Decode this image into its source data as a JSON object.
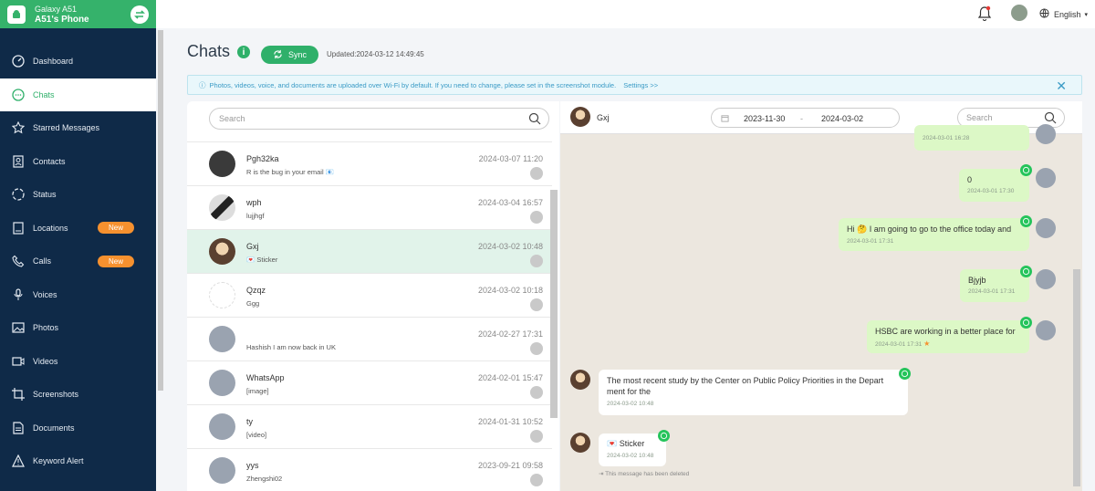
{
  "device": {
    "name": "Galaxy A51",
    "phone": "A51's Phone"
  },
  "topbar": {
    "language": "English"
  },
  "sidebar": {
    "items": [
      {
        "label": "Dashboard"
      },
      {
        "label": "Chats"
      },
      {
        "label": "Starred Messages"
      },
      {
        "label": "Contacts"
      },
      {
        "label": "Status"
      },
      {
        "label": "Locations",
        "badge": "New"
      },
      {
        "label": "Calls",
        "badge": "New"
      },
      {
        "label": "Voices"
      },
      {
        "label": "Photos"
      },
      {
        "label": "Videos"
      },
      {
        "label": "Screenshots"
      },
      {
        "label": "Documents"
      },
      {
        "label": "Keyword Alert"
      }
    ]
  },
  "header": {
    "title": "Chats",
    "info": "i",
    "sync_label": "Sync",
    "updated": "Updated:2024-03-12 14:49:45"
  },
  "notice": {
    "text": "Photos, videos, voice, and documents are uploaded over Wi-Fi by default. If you need to change, please set in the screenshot module.",
    "link": "Settings >>"
  },
  "list": {
    "search_placeholder": "Search",
    "rows": [
      {
        "name": "Pgh32ka",
        "msg": "R is the bug in your email 📧",
        "time": "2024-03-07 11:20"
      },
      {
        "name": "wph",
        "msg": "lujjhgf",
        "time": "2024-03-04 16:57"
      },
      {
        "name": "Gxj",
        "msg": "💌 Sticker",
        "time": "2024-03-02 10:48"
      },
      {
        "name": "Qzqz",
        "msg": "Ggg",
        "time": "2024-03-02 10:18"
      },
      {
        "name": "",
        "msg": "Hashish I am now back in UK",
        "time": "2024-02-27 17:31"
      },
      {
        "name": "WhatsApp",
        "msg": "[image]",
        "time": "2024-02-01 15:47"
      },
      {
        "name": "ty",
        "msg": "[video]",
        "time": "2024-01-31 10:52"
      },
      {
        "name": "yys",
        "msg": "Zhengshi02",
        "time": "2023-09-21 09:58"
      }
    ]
  },
  "chat": {
    "contact": "Gxj",
    "date_from": "2023-11-30",
    "date_sep": "-",
    "date_to": "2024-03-02",
    "search_placeholder": "Search",
    "messages": [
      {
        "text": "",
        "time": "2024-03-01 16:28"
      },
      {
        "text": "0",
        "time": "2024-03-01 17:30"
      },
      {
        "text": "Hi 🤔 I am going to go to the office today and",
        "time": "2024-03-01 17:31"
      },
      {
        "text": "Bjyjb",
        "time": "2024-03-01 17:31"
      },
      {
        "text": "HSBC are working in a better place for",
        "time": "2024-03-01 17:31"
      },
      {
        "text": "The most recent study by the Center on Public Policy Priorities in the Depart ment for the",
        "time": "2024-03-02 10:48"
      },
      {
        "text": "💌 Sticker",
        "time": "2024-03-02 10:48"
      }
    ],
    "deleted_note": "⇥ This message has been deleted"
  }
}
